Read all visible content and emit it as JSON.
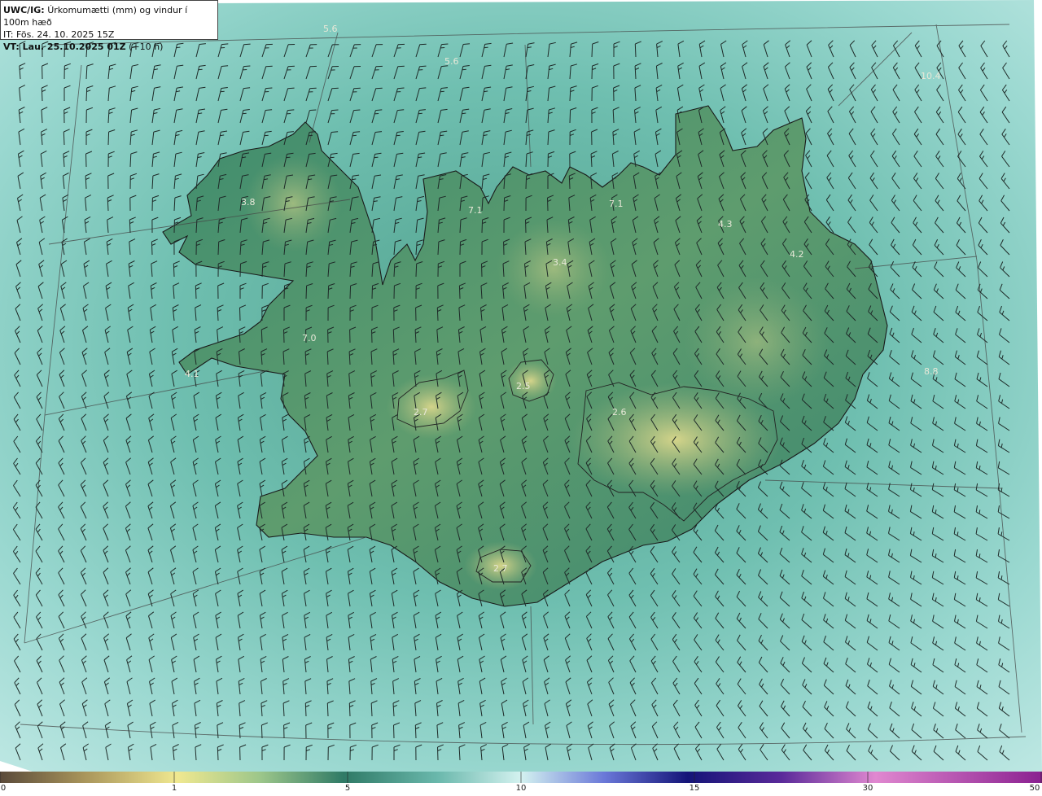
{
  "header": {
    "model": "UWC/IG:",
    "field": "Úrkomumætti (mm) og vindur í 100m hæð",
    "init_time": "IT: Fös. 24. 10. 2025 15Z",
    "valid_label": "VT: Lau. 25.10.2025 01Z",
    "lead": "(+10 h)"
  },
  "map_labels": [
    "5.6",
    "5.6",
    "3.8",
    "7.1",
    "7.1",
    "4.3",
    "4.2",
    "3.4",
    "7.0",
    "4.1",
    "2.7",
    "2.5",
    "2.6",
    "2.7",
    "10.4",
    "8.8"
  ],
  "colorbar": {
    "ticks": [
      "0",
      "1",
      "5",
      "10",
      "15",
      "30",
      "50"
    ],
    "colors": [
      "#5a4a3a",
      "#a8945a",
      "#dcd48a",
      "#f0e890",
      "#9cc68a",
      "#5fa67e",
      "#2f7a66",
      "#3e8e80",
      "#6ab8ac",
      "#a0dcd8",
      "#d4f2f0",
      "#c8d8f0",
      "#6a78d8",
      "#2a2aa0",
      "#141478",
      "#5a2a9a",
      "#a84ab0",
      "#e088d0",
      "#c040b0",
      "#8a2090"
    ]
  },
  "colors": {
    "ocean": "#7fcbc0",
    "land_low": "#2e7c66",
    "land_high": "#c8cc7c",
    "coast": "#1a1a1a"
  }
}
